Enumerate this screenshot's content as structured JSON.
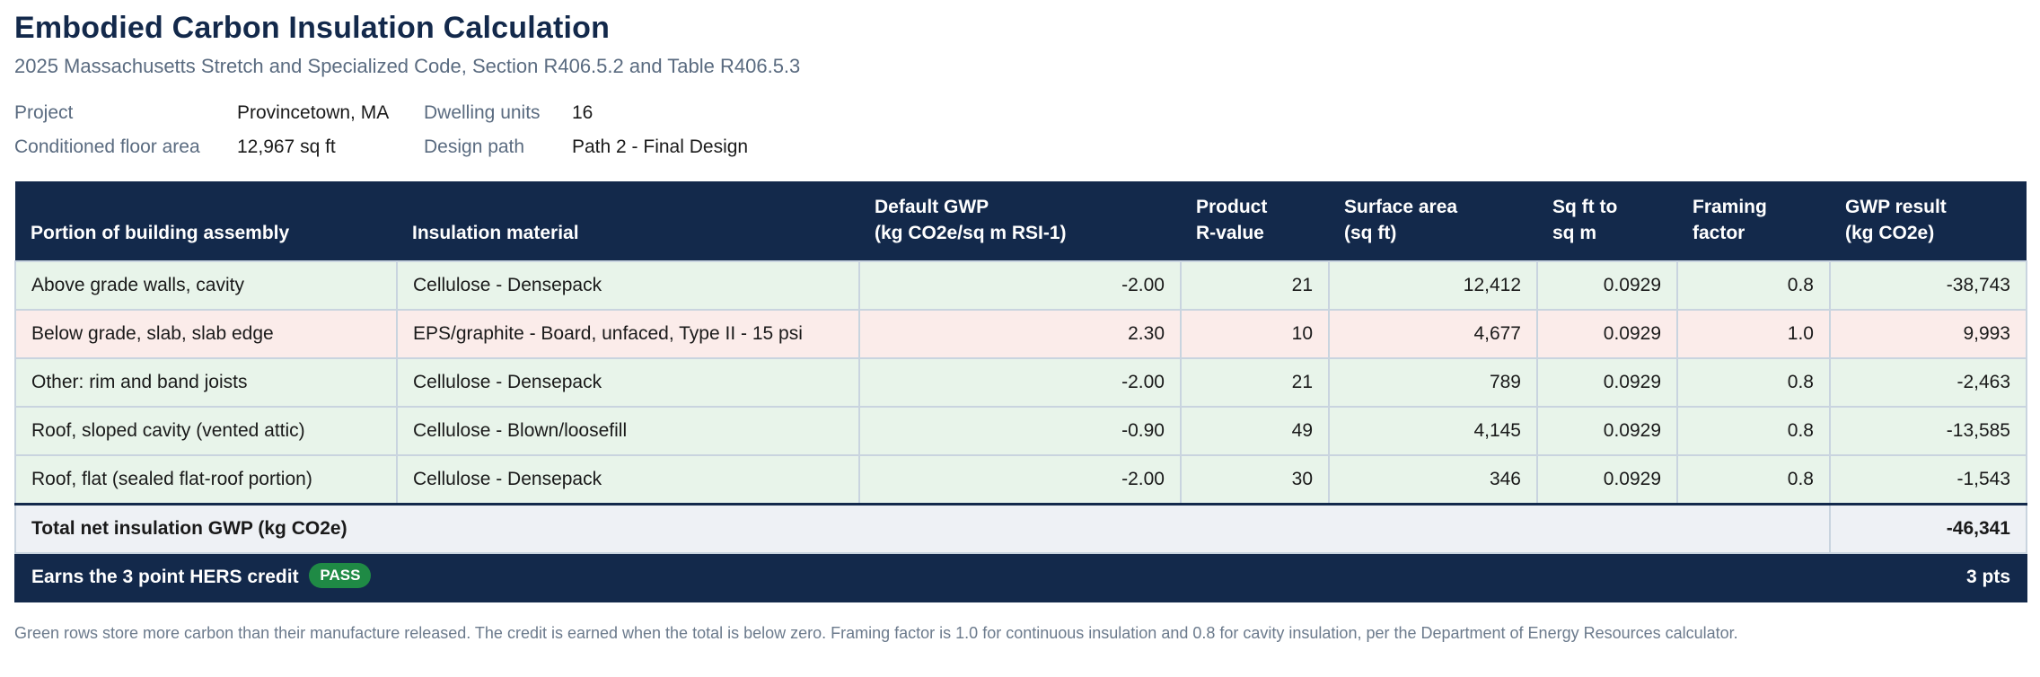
{
  "title": "Embodied Carbon Insulation Calculation",
  "subtitle": "2025 Massachusetts Stretch and Specialized Code, Section R406.5.2 and Table R406.5.3",
  "meta": {
    "project_label": "Project",
    "project_value": "Provincetown, MA",
    "units_label": "Dwelling units",
    "units_value": "16",
    "area_label": "Conditioned floor area",
    "area_value": "12,967 sq ft",
    "path_label": "Design path",
    "path_value": "Path 2 - Final Design"
  },
  "table": {
    "headers": {
      "portion": "Portion of building assembly",
      "material": "Insulation material",
      "gwp_line1": "Default GWP",
      "gwp_line2": "(kg CO2e/sq m RSI-1)",
      "rvalue_line1": "Product",
      "rvalue_line2": "R-value",
      "area_line1": "Surface area",
      "area_line2": "(sq ft)",
      "conv_line1": "Sq ft to",
      "conv_line2": "sq m",
      "framing_line1": "Framing",
      "framing_line2": "factor",
      "result_line1": "GWP result",
      "result_line2": "(kg CO2e)"
    },
    "rows": [
      {
        "portion": "Above grade walls, cavity",
        "material": "Cellulose - Densepack",
        "gwp": "-2.00",
        "rvalue": "21",
        "area": "12,412",
        "conv": "0.0929",
        "framing": "0.8",
        "result": "-38,743",
        "tone": "neg"
      },
      {
        "portion": "Below grade, slab, slab edge",
        "material": "EPS/graphite - Board, unfaced, Type II - 15 psi",
        "gwp": "2.30",
        "rvalue": "10",
        "area": "4,677",
        "conv": "0.0929",
        "framing": "1.0",
        "result": "9,993",
        "tone": "pos"
      },
      {
        "portion": "Other: rim and band joists",
        "material": "Cellulose - Densepack",
        "gwp": "-2.00",
        "rvalue": "21",
        "area": "789",
        "conv": "0.0929",
        "framing": "0.8",
        "result": "-2,463",
        "tone": "neg"
      },
      {
        "portion": "Roof, sloped cavity (vented attic)",
        "material": "Cellulose - Blown/loosefill",
        "gwp": "-0.90",
        "rvalue": "49",
        "area": "4,145",
        "conv": "0.0929",
        "framing": "0.8",
        "result": "-13,585",
        "tone": "neg"
      },
      {
        "portion": "Roof, flat (sealed flat-roof portion)",
        "material": "Cellulose - Densepack",
        "gwp": "-2.00",
        "rvalue": "30",
        "area": "346",
        "conv": "0.0929",
        "framing": "0.8",
        "result": "-1,543",
        "tone": "neg"
      }
    ],
    "total_label": "Total net insulation GWP (kg CO2e)",
    "total_value": "-46,341",
    "credit_label": "Earns the 3 point HERS credit",
    "credit_badge": "PASS",
    "credit_value": "3 pts"
  },
  "colors": {
    "navy": "#13294b",
    "carbon_storing_row": "#e8f4ea",
    "carbon_emitting_row": "#fbecea",
    "pass_badge": "#1f8a45"
  },
  "footnote": "Green rows store more carbon than their manufacture released. The credit is earned when the total is below zero. Framing factor is 1.0 for continuous insulation and 0.8 for cavity insulation, per the Department of Energy Resources calculator."
}
